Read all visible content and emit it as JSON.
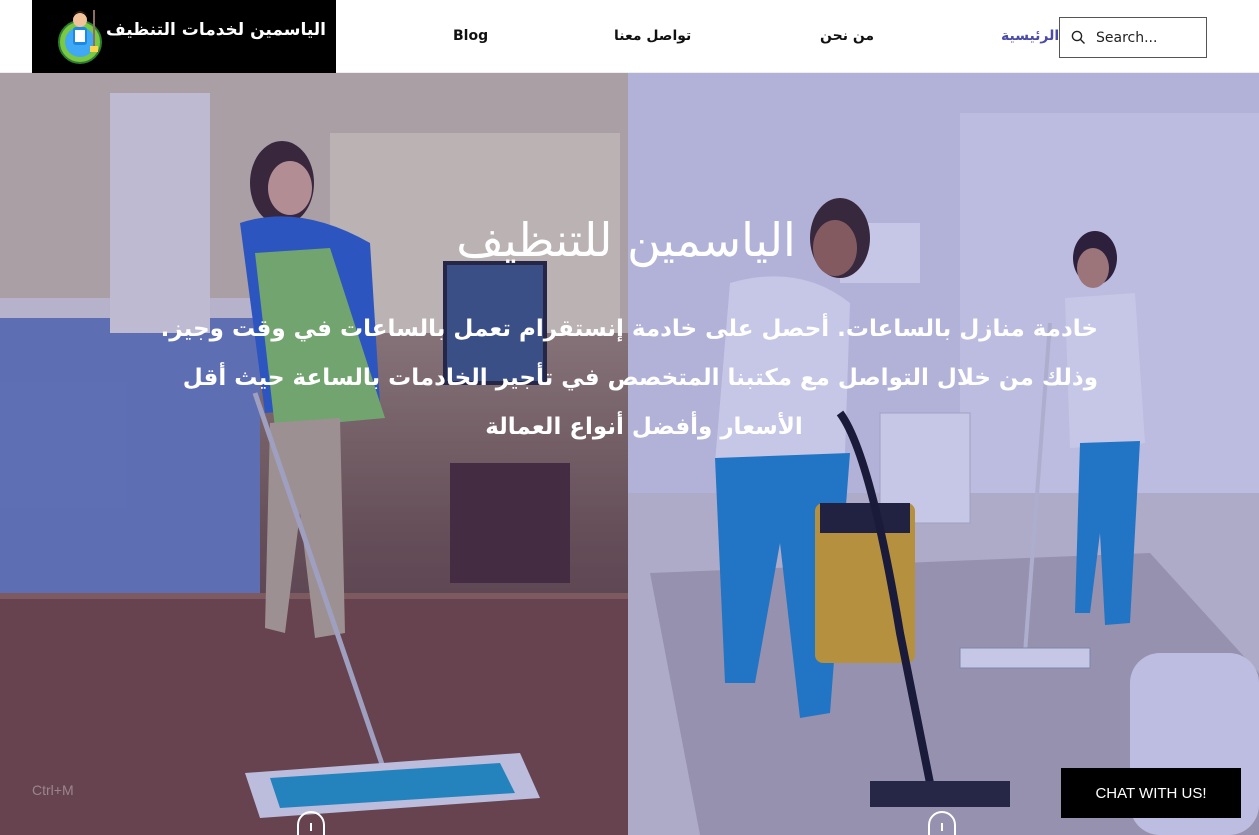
{
  "header": {
    "logo_text": "الياسمين لخدمات التنظيف",
    "nav": {
      "blog": "Blog",
      "contact": "تواصل معنا",
      "about": "من نحن",
      "home": "الرئيسية"
    },
    "search": {
      "placeholder": "Search..."
    }
  },
  "hero": {
    "title": "الياسمين للتنظيف",
    "body_line1": "خادمة منازل بالساعات. أحصل على خادمة إنستقرام  تعمل بالساعات في وقت وجيز.",
    "body_line2": "وذلك من خلال التواصل مع مكتبنا المتخصص في تأجير الخادمات بالساعة حيث أقل",
    "body_line3": "الأسعار وأفضل أنواع العمالة"
  },
  "chat": {
    "label": "CHAT WITH US!"
  },
  "hint": {
    "text": "Ctrl+M"
  },
  "colors": {
    "nav_active": "#4b4ba8",
    "logo_bg": "#000000",
    "chat_bg": "#000000",
    "overlay": "rgba(50,50,170,0.28)"
  }
}
